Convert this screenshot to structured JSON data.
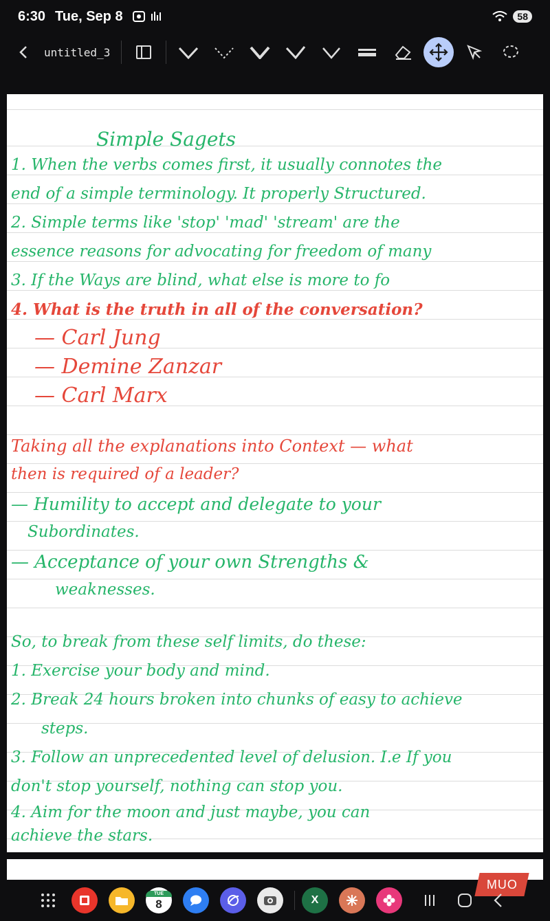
{
  "status_bar": {
    "time": "6:30",
    "date": "Tue, Sep 8",
    "battery": "58"
  },
  "toolbar": {
    "title": "untitled_3",
    "tools": [
      "back-icon",
      "sidebar-icon",
      "pen-icon",
      "dotted-pen-icon",
      "fountain-pen-icon",
      "calligraphy-pen-icon",
      "brush-icon",
      "highlighter-icon",
      "eraser-icon",
      "move-icon",
      "pointer-icon",
      "lasso-icon"
    ]
  },
  "note": {
    "lines": [
      {
        "text": "Simple Sagets",
        "color": "green"
      },
      {
        "text": "1. When the verbs comes first, it usually connotes the",
        "color": "green"
      },
      {
        "text": "end of a simple terminology. It properly Structured.",
        "color": "green"
      },
      {
        "text": "2. Simple terms like 'stop' 'mad' 'stream' are the",
        "color": "green"
      },
      {
        "text": "essence reasons for advocating for freedom of many",
        "color": "green"
      },
      {
        "text": "3. If the Ways are blind, what else is more to fo",
        "color": "green"
      },
      {
        "text": "4. What is the truth in all of the conversation?",
        "color": "red"
      },
      {
        "text": "— Carl Jung",
        "color": "red"
      },
      {
        "text": "— Demine Zanzar",
        "color": "red"
      },
      {
        "text": "— Carl Marx",
        "color": "red"
      },
      {
        "text": "Taking all the explanations into Context — what",
        "color": "red"
      },
      {
        "text": "then is required of a leader?",
        "color": "red"
      },
      {
        "text": "— Humility to accept and delegate to your",
        "color": "green"
      },
      {
        "text": "Subordinates.",
        "color": "green"
      },
      {
        "text": "— Acceptance of your own Strengths &",
        "color": "green"
      },
      {
        "text": "weaknesses.",
        "color": "green"
      },
      {
        "text": "So, to break from these self limits, do these:",
        "color": "green"
      },
      {
        "text": "1. Exercise your body and mind.",
        "color": "green"
      },
      {
        "text": "2. Break 24 hours broken into chunks of easy to achieve",
        "color": "green"
      },
      {
        "text": "steps.",
        "color": "green"
      },
      {
        "text": "3. Follow an unprecedented level of delusion. I.e If you",
        "color": "green"
      },
      {
        "text": "don't stop yourself, nothing can stop you.",
        "color": "green"
      },
      {
        "text": "4. Aim for the moon and just maybe, you can",
        "color": "green"
      },
      {
        "text": "achieve the stars.",
        "color": "green"
      }
    ]
  },
  "navbar": {
    "apps": [
      "flipboard-app-icon",
      "files-app-icon",
      "calendar-app-icon",
      "messages-app-icon",
      "internet-app-icon",
      "camera-app-icon",
      "excel-app-icon",
      "claude-app-icon",
      "gallery-app-icon"
    ],
    "calendar_day": "TUE",
    "calendar_date": "8",
    "excel_letter": "X"
  },
  "watermark": "MUO"
}
